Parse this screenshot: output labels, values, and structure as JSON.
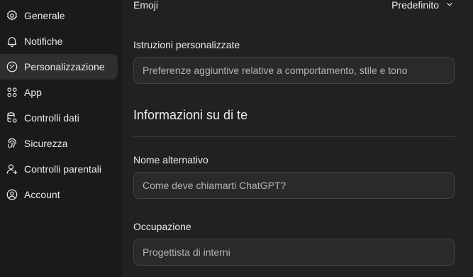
{
  "sidebar": {
    "items": [
      {
        "label": "Generale",
        "icon": "gear-icon"
      },
      {
        "label": "Notifiche",
        "icon": "bell-icon"
      },
      {
        "label": "Personalizzazione",
        "icon": "personalization-icon"
      },
      {
        "label": "App",
        "icon": "apps-grid-icon"
      },
      {
        "label": "Controlli dati",
        "icon": "database-settings-icon"
      },
      {
        "label": "Sicurezza",
        "icon": "fingerprint-icon"
      },
      {
        "label": "Controlli parentali",
        "icon": "parent-user-icon"
      },
      {
        "label": "Account",
        "icon": "user-circle-icon"
      }
    ],
    "active_item": "Personalizzazione"
  },
  "main": {
    "emoji": {
      "label": "Emoji",
      "value": "Predefinito"
    },
    "custom_instructions": {
      "label": "Istruzioni personalizzate",
      "placeholder": "Preferenze aggiuntive relative a comportamento, stile e tono"
    },
    "about_section_title": "Informazioni su di te",
    "nickname": {
      "label": "Nome alternativo",
      "placeholder": "Come deve chiamarti ChatGPT?"
    },
    "occupation": {
      "label": "Occupazione",
      "placeholder": "Progettista di interni"
    }
  }
}
